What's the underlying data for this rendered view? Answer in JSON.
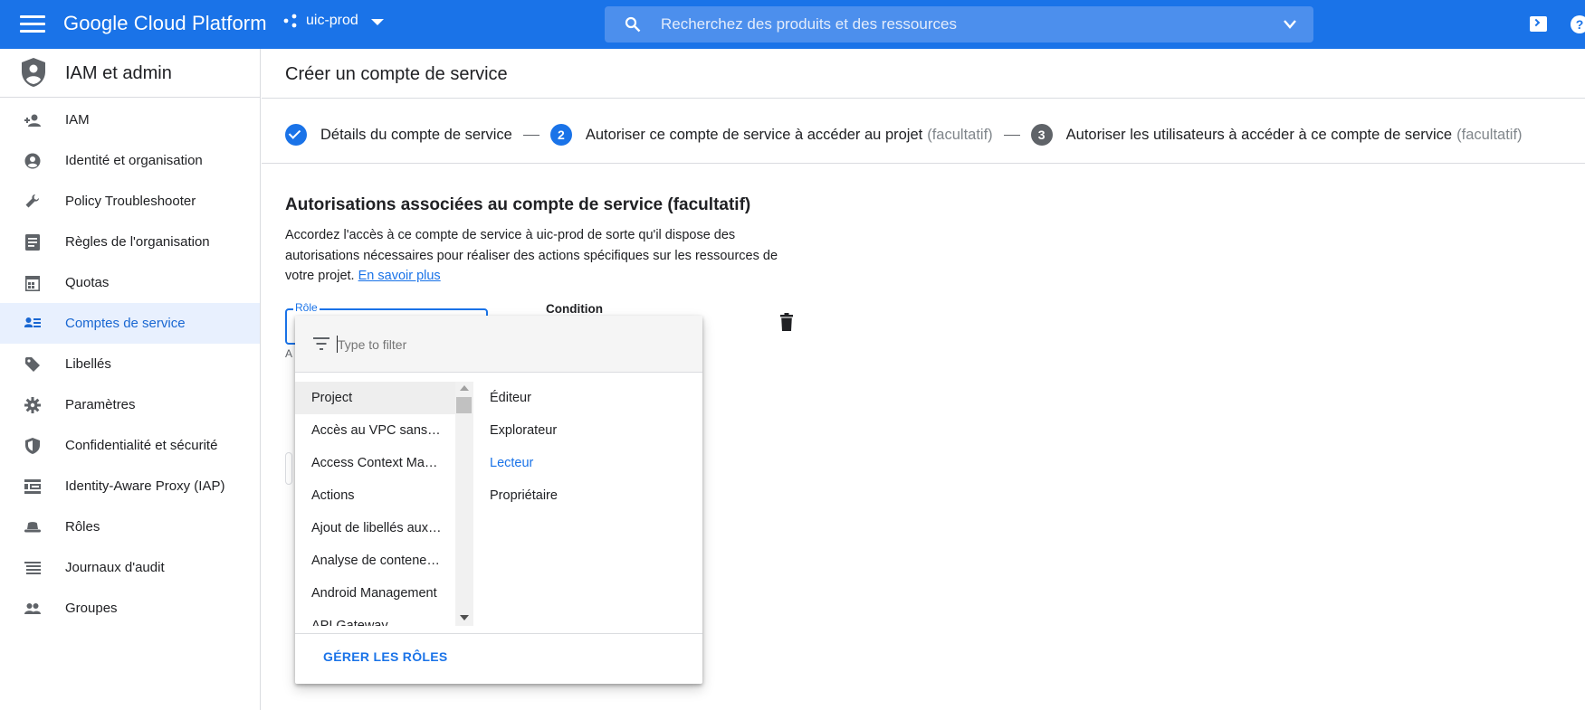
{
  "topbar": {
    "brand": "Google Cloud Platform",
    "project": "uic-prod",
    "search_placeholder": "Recherchez des produits et des ressources"
  },
  "sidebar": {
    "title": "IAM et admin",
    "items": [
      {
        "label": "IAM",
        "icon": "person-add-icon"
      },
      {
        "label": "Identité et organisation",
        "icon": "account-circle-icon"
      },
      {
        "label": "Policy Troubleshooter",
        "icon": "wrench-icon"
      },
      {
        "label": "Règles de l'organisation",
        "icon": "document-list-icon"
      },
      {
        "label": "Quotas",
        "icon": "calendar-grid-icon"
      },
      {
        "label": "Comptes de service",
        "icon": "service-account-icon",
        "active": true
      },
      {
        "label": "Libellés",
        "icon": "label-tag-icon"
      },
      {
        "label": "Paramètres",
        "icon": "gear-icon"
      },
      {
        "label": "Confidentialité et sécurité",
        "icon": "shield-icon"
      },
      {
        "label": "Identity-Aware Proxy (IAP)",
        "icon": "proxy-icon"
      },
      {
        "label": "Rôles",
        "icon": "hat-icon"
      },
      {
        "label": "Journaux d'audit",
        "icon": "list-lines-icon"
      },
      {
        "label": "Groupes",
        "icon": "people-icon"
      }
    ]
  },
  "main": {
    "page_title": "Créer un compte de service",
    "stepper": {
      "step1": "Détails du compte de service",
      "step2_num": "2",
      "step2": "Autoriser ce compte de service à accéder au projet",
      "step2_suffix": "(facultatif)",
      "step3_num": "3",
      "step3": "Autoriser les utilisateurs à accéder à ce compte de service",
      "step3_suffix": "(facultatif)"
    },
    "section_title": "Autorisations associées au compte de service (facultatif)",
    "section_desc": "Accordez l'accès à ce compte de service à uic-prod de sorte qu'il dispose des autorisations nécessaires pour réaliser des actions spécifiques sur les ressources de votre projet.",
    "learn_more": "En savoir plus",
    "role_label": "Rôle",
    "role_hint": "Ac",
    "condition_label": "Condition"
  },
  "dropdown": {
    "filter_placeholder": "Type to filter",
    "categories": [
      "Project",
      "Accès au VPC sans serveur",
      "Access Context Manager",
      "Actions",
      "Ajout de libellés aux ressources",
      "Analyse de conteneurs",
      "Android Management",
      "API Gateway"
    ],
    "selected_category": "Project",
    "roles": [
      "Éditeur",
      "Explorateur",
      "Lecteur",
      "Propriétaire"
    ],
    "highlighted_role": "Lecteur",
    "footer_button": "GÉRER LES RÔLES"
  },
  "colors": {
    "brand_blue": "#1a73e8",
    "active_bg": "#e8f0fe"
  }
}
